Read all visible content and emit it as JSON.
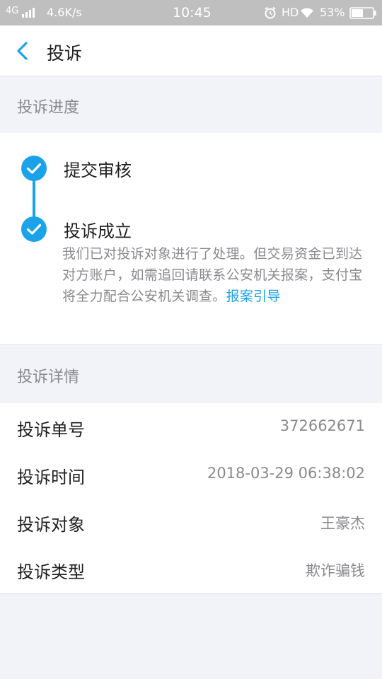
{
  "status_bar": {
    "network": "4G",
    "speed": "4.6K/s",
    "time": "10:45",
    "hd": "HD",
    "battery": "53%"
  },
  "nav": {
    "title": "投诉"
  },
  "progress_section": {
    "title": "投诉进度",
    "steps": [
      {
        "title": "提交审核"
      },
      {
        "title": "投诉成立",
        "description": "我们已对投诉对象进行了处理。但交易资金已到达对方账户，如需追回请联系公安机关报案，支付宝将全力配合公安机关调查。",
        "link": "报案引导"
      }
    ]
  },
  "details_section": {
    "title": "投诉详情",
    "rows": [
      {
        "label": "投诉单号",
        "value": "372662671"
      },
      {
        "label": "投诉时间",
        "value": "2018-03-29 06:38:02"
      },
      {
        "label": "投诉对象",
        "value": "王豪杰"
      },
      {
        "label": "投诉类型",
        "value": "欺诈骗钱"
      }
    ]
  },
  "colors": {
    "accent": "#1aa2ea",
    "background": "#f2f2f9",
    "secondary_text": "#8a8a8e"
  }
}
